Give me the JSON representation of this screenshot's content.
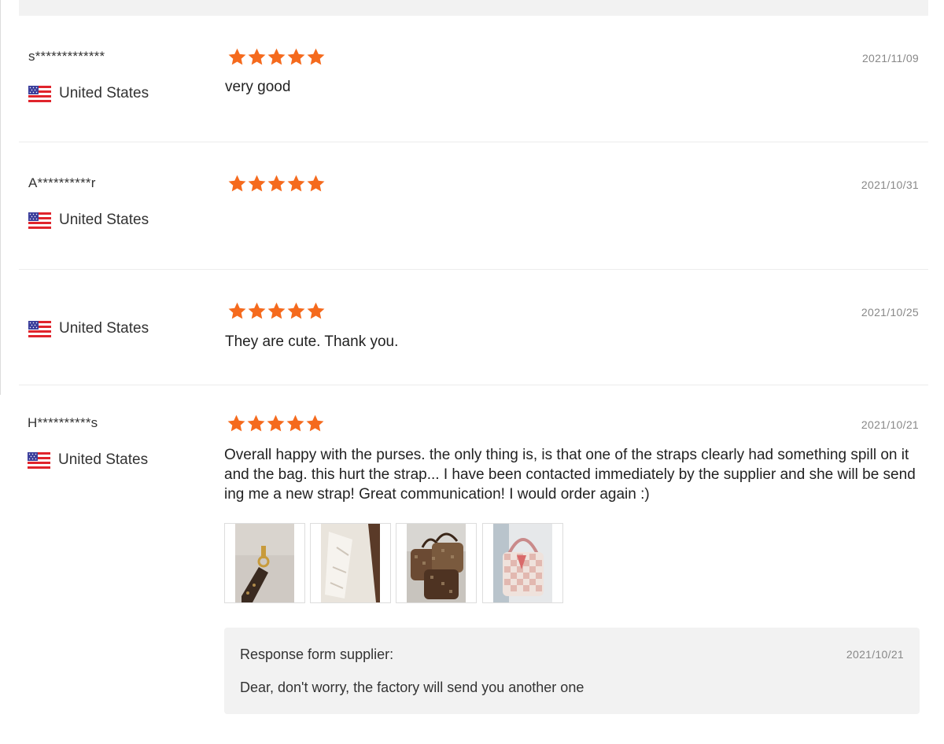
{
  "colors": {
    "star": "#f56a1d",
    "accent_bg": "#f2f2f2",
    "date_text": "#888888"
  },
  "icons": {
    "rating": "star-icon",
    "flag": "us-flag-icon"
  },
  "reviews": [
    {
      "user": "s*************",
      "country": "United States",
      "rating": 5,
      "date": "2021/11/09",
      "comment": "very good"
    },
    {
      "user": "A**********r",
      "country": "United States",
      "rating": 5,
      "date": "2021/10/31",
      "comment": ""
    },
    {
      "user": "",
      "country": "United States",
      "rating": 5,
      "date": "2021/10/25",
      "comment": "They are cute. Thank you."
    },
    {
      "user": "H**********s",
      "country": "United States",
      "rating": 5,
      "date": "2021/10/21",
      "comment": "Overall happy with the purses. the only thing is, is that one of the straps clearly had something spill on it and the bag. this hurt the strap... I have been contacted immediately by the supplier and she will be sending me a new strap! Great communication! I would order again :)",
      "response": {
        "title": "Response form supplier:",
        "date": "2021/10/21",
        "text": "Dear, don't worry, the factory will send you another one"
      }
    }
  ]
}
